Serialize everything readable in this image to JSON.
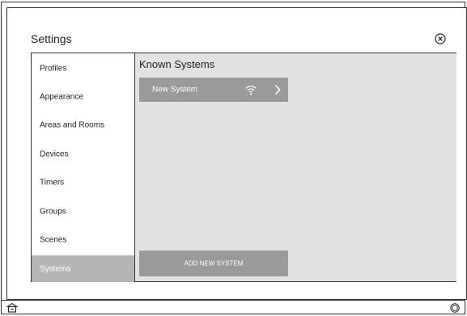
{
  "header": {
    "title": "Settings"
  },
  "icons": {
    "close": "close-circle-icon",
    "wifi": "wifi-icon",
    "chevron": "chevron-right-icon",
    "home": "home-icon",
    "power": "circle-button-icon"
  },
  "sidebar": {
    "items": [
      {
        "label": "Profiles",
        "active": false
      },
      {
        "label": "Appearance",
        "active": false
      },
      {
        "label": "Areas and Rooms",
        "active": false
      },
      {
        "label": "Devices",
        "active": false
      },
      {
        "label": "Timers",
        "active": false
      },
      {
        "label": "Groups",
        "active": false
      },
      {
        "label": "Scenes",
        "active": false
      },
      {
        "label": "Systems",
        "active": true
      }
    ]
  },
  "main": {
    "title": "Known Systems",
    "systems": [
      {
        "name": "New System"
      }
    ],
    "add_button": "ADD NEW SYSTEM"
  },
  "colors": {
    "active_item": "#b5b5b5",
    "card": "#9a9a9a",
    "content_bg": "#e2e2e2"
  }
}
